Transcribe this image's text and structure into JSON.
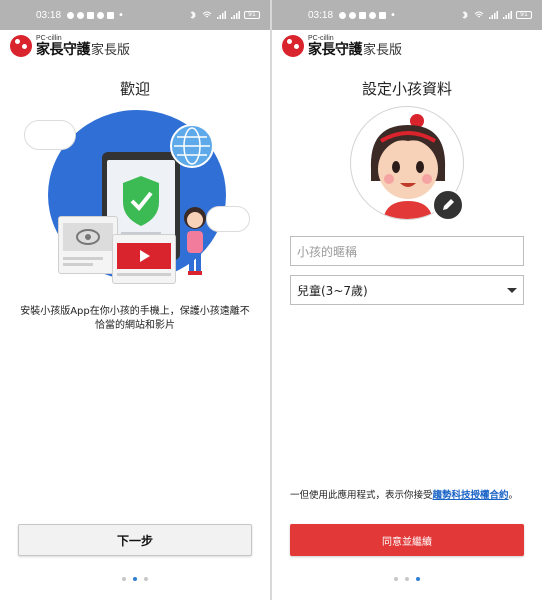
{
  "left": {
    "status": {
      "time": "03:18",
      "battery": "91"
    },
    "app": {
      "brand": "PC-cillin",
      "name_main": "家長守護",
      "name_sub": "家長版"
    },
    "title": "歡迎",
    "description": "安裝小孩版App在你小孩的手機上，保護小孩遠離不恰當的網站和影片",
    "next_button": "下一步",
    "page_index": 2,
    "page_count": 3
  },
  "right": {
    "status": {
      "time": "03:18",
      "battery": "91"
    },
    "app": {
      "brand": "PC-cillin",
      "name_main": "家長守護",
      "name_sub": "家長版"
    },
    "title": "設定小孩資料",
    "nickname_placeholder": "小孩的暱稱",
    "age_select_value": "兒童(3~7歲)",
    "terms_prefix": "一但使用此應用程式，表示你接受",
    "terms_link": "趨勢科技授權合約",
    "terms_suffix": "。",
    "agree_button": "同意並繼續",
    "page_index": 3,
    "page_count": 3
  },
  "colors": {
    "accent_red": "#e23838",
    "link_blue": "#1a63c6",
    "page_dot_active": "#2f7fd6",
    "status_bar": "#b3b3b3"
  }
}
